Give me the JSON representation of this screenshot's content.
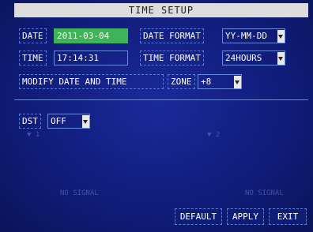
{
  "title": "TIME SETUP",
  "date": {
    "label": "DATE",
    "value": "2011-03-04"
  },
  "date_format": {
    "label": "DATE FORMAT",
    "value": "YY-MM-DD"
  },
  "time": {
    "label": "TIME",
    "value": "17:14:31"
  },
  "time_format": {
    "label": "TIME FORMAT",
    "value": "24HOURS"
  },
  "modify_label": "MODIFY DATE AND TIME",
  "zone": {
    "label": "ZONE",
    "value": "+8"
  },
  "dst": {
    "label": "DST",
    "value": "OFF"
  },
  "ghost": {
    "ch1": "1",
    "ch2": "2",
    "no_signal_1": "NO SIGNAL",
    "no_signal_2": "NO SIGNAL"
  },
  "buttons": {
    "default": "DEFAULT",
    "apply": "APPLY",
    "exit": "EXIT"
  },
  "colors": {
    "background": "#101c78",
    "selected_field": "#3fb35a",
    "title_bar": "#dcdcdc"
  }
}
